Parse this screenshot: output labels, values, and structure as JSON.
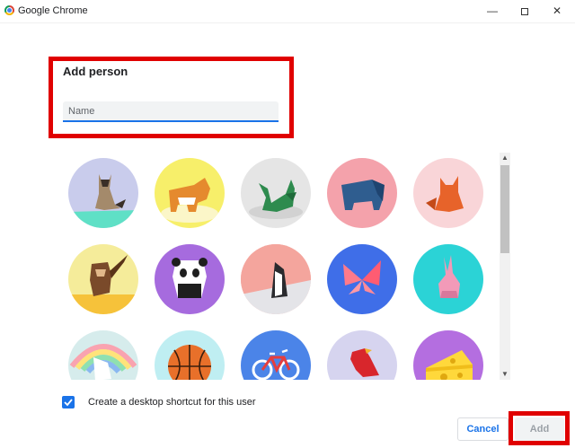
{
  "window": {
    "title": "Google Chrome",
    "minimize_glyph": "—",
    "close_glyph": "✕"
  },
  "dialog": {
    "heading": "Add person",
    "name_placeholder": "Name",
    "name_value": ""
  },
  "avatars": [
    {
      "icon": "origami-cat-avatar",
      "bg": "#c9ccec"
    },
    {
      "icon": "origami-corgi-avatar",
      "bg": "#f7ef6a"
    },
    {
      "icon": "origami-dragon-avatar",
      "bg": "#e5e5e5"
    },
    {
      "icon": "origami-elephant-avatar",
      "bg": "#f4a2ab"
    },
    {
      "icon": "origami-fox-avatar",
      "bg": "#f9d5d8"
    },
    {
      "icon": "origami-monkey-avatar",
      "bg": "#f5ec9a"
    },
    {
      "icon": "origami-panda-avatar",
      "bg": "#a66bde"
    },
    {
      "icon": "origami-penguin-avatar",
      "bg": "#f6b6b0"
    },
    {
      "icon": "origami-butterfly-avatar",
      "bg": "#3f6ee8"
    },
    {
      "icon": "origami-rabbit-avatar",
      "bg": "#2bd3d6"
    },
    {
      "icon": "origami-unicorn-avatar",
      "bg": "#d6ecec"
    },
    {
      "icon": "basketball-avatar",
      "bg": "#bfeef2"
    },
    {
      "icon": "bicycle-avatar",
      "bg": "#4b84e8"
    },
    {
      "icon": "bird-avatar",
      "bg": "#d6d4ef"
    },
    {
      "icon": "cheese-avatar",
      "bg": "#b46ee0"
    }
  ],
  "scrollbar": {
    "up": "▲",
    "down": "▼"
  },
  "shortcut": {
    "label": "Create a desktop shortcut for this user",
    "checked": true
  },
  "buttons": {
    "cancel": "Cancel",
    "add": "Add"
  },
  "colors": {
    "accent": "#1a73e8",
    "highlight": "#e00000"
  }
}
